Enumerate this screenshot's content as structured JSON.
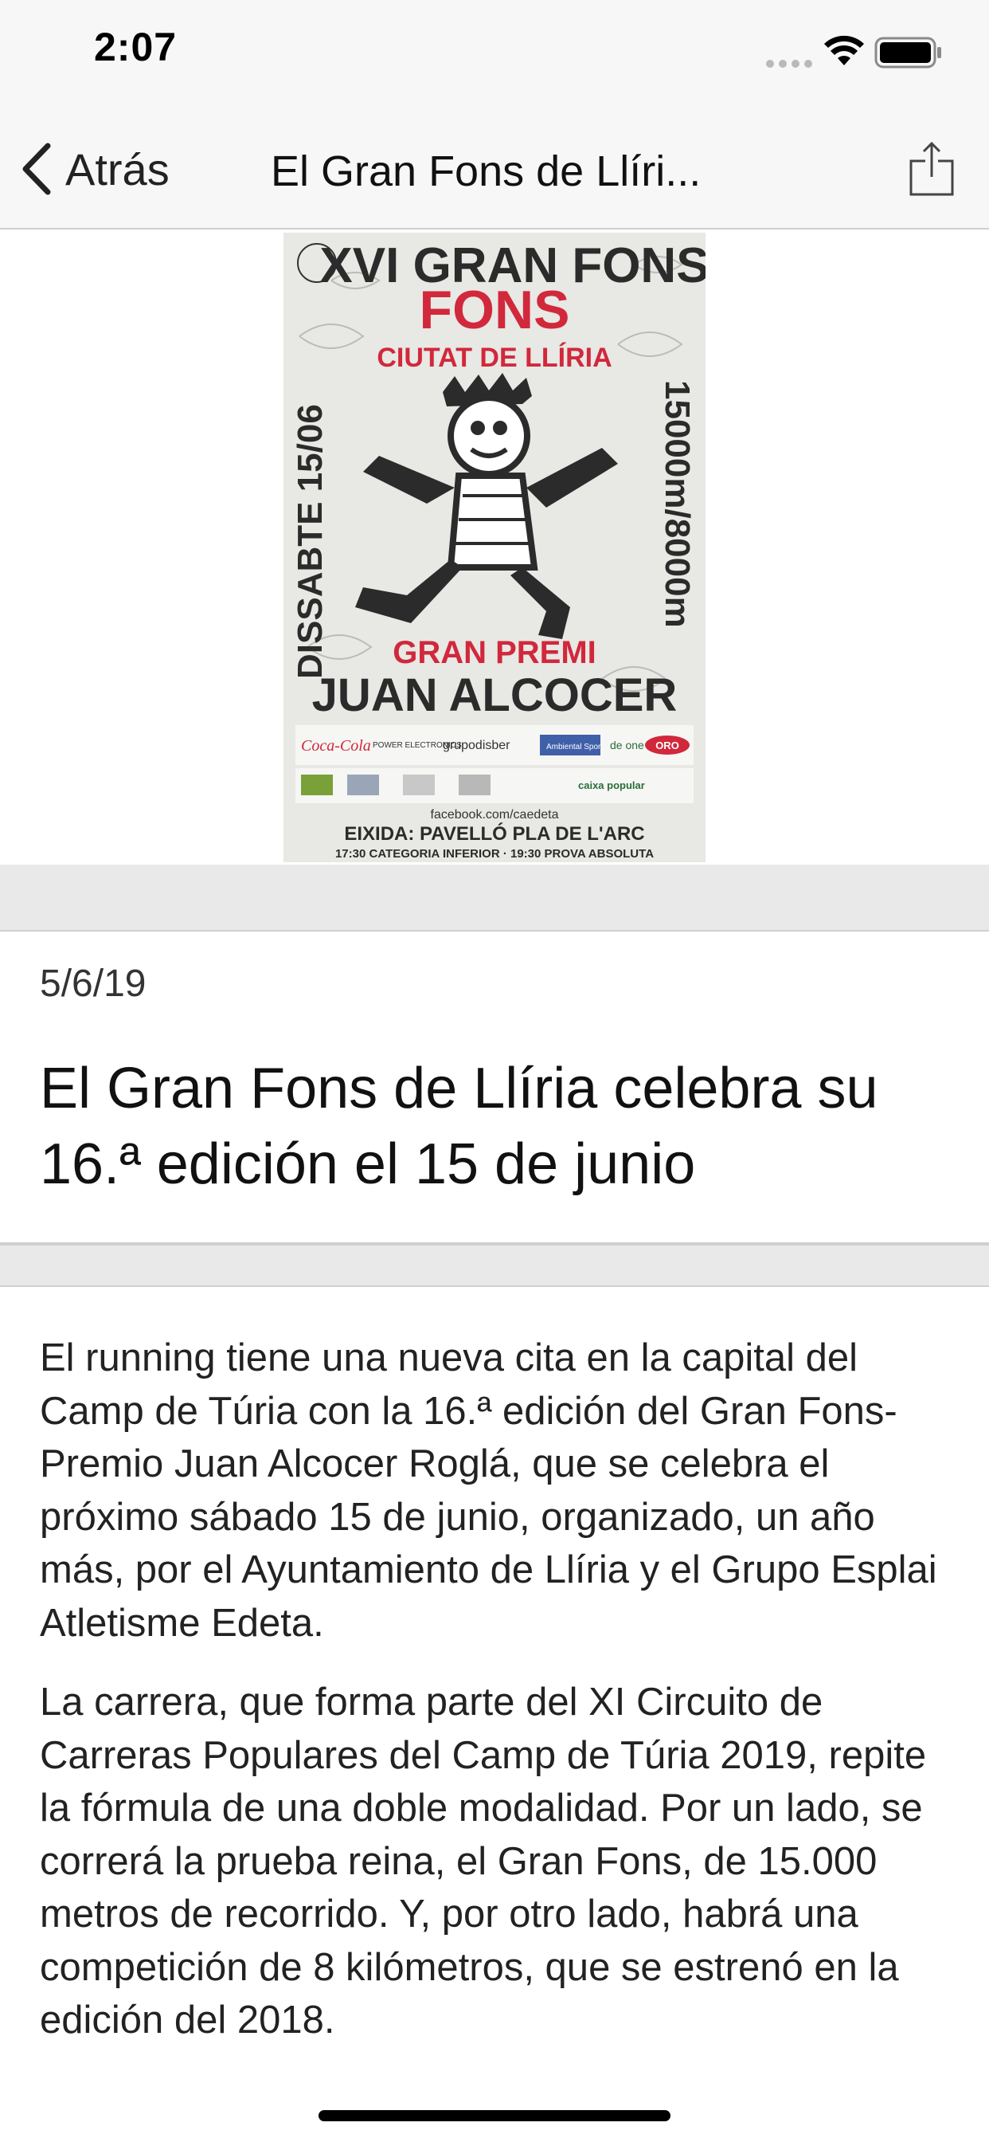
{
  "status_bar": {
    "time": "2:07"
  },
  "nav": {
    "back_label": "Atrás",
    "title": "El Gran Fons de Llíri..."
  },
  "poster": {
    "top_heading": "XVI GRAN FONS",
    "city_line": "CIUTAT DE LLÍRIA",
    "left_vertical": "DISSABTE 15/06",
    "right_vertical": "15000m/8000m",
    "prize_line": "GRAN PREMI",
    "name_line": "JUAN ALCOCER",
    "sponsors": [
      "Coca-Cola",
      "POWER ELECTRONICS",
      "grupodisber",
      "Ambiental Sport",
      "de one",
      "ORO",
      "caixa popular"
    ],
    "facebook": "facebook.com/caedeta",
    "start_line": "EIXIDA: PAVELLÓ PLA DE L'ARC",
    "times_line": "17:30 CATEGORIA INFERIOR · 19:30 PROVA ABSOLUTA"
  },
  "article": {
    "date": "5/6/19",
    "title": "El Gran Fons de Llíria celebra su 16.ª edición el 15 de junio",
    "paragraphs": [
      "El running tiene una nueva cita en la capital del Camp de Túria con la 16.ª edición del Gran Fons-Premio Juan Alcocer Roglá, que se celebra el próximo sábado 15 de junio, organizado, un año más, por el Ayuntamiento de Llíria y el Grupo Esplai Atletisme Edeta.",
      "La carrera, que forma parte del XI Circuito de Carreras Populares del Camp de Túria 2019, repite la fórmula de una doble modalidad. Por un lado, se correrá la prueba reina, el Gran Fons, de 15.000 metros de recorrido. Y, por otro lado, habrá una competición de 8 kilómetros, que se estrenó en la edición del 2018."
    ]
  },
  "colors": {
    "poster_red": "#d1283c",
    "poster_dark": "#2b2b2b",
    "nav_bg": "#f7f7f7"
  }
}
